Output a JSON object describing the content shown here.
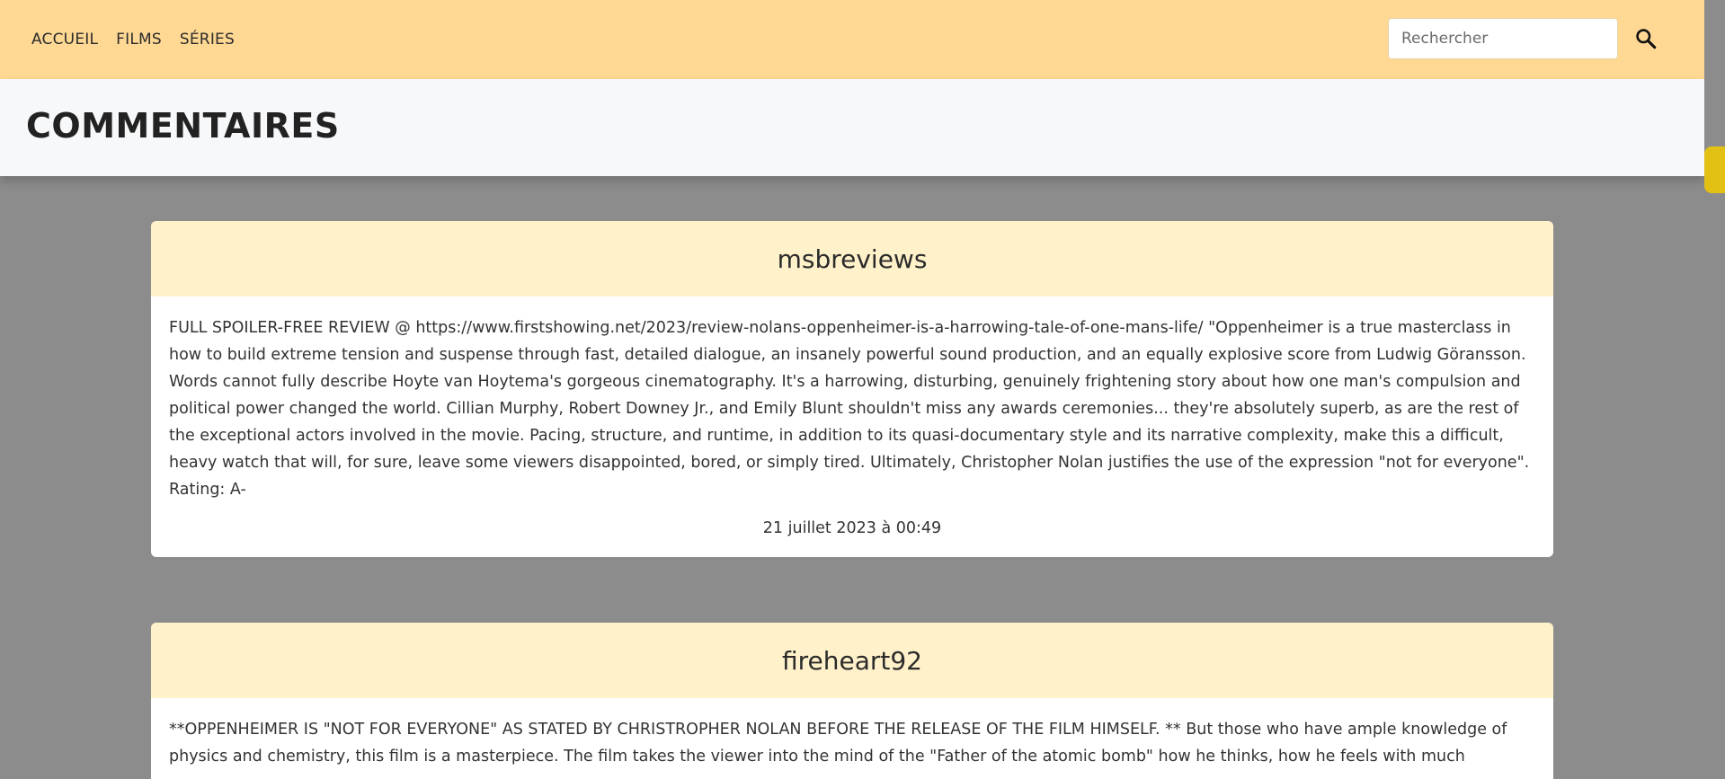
{
  "nav": {
    "links": [
      "ACCUEIL",
      "FILMS",
      "SÉRIES"
    ],
    "search_placeholder": "Rechercher",
    "search_icon": "search-icon"
  },
  "header": {
    "title": "COMMENTAIRES"
  },
  "comments": [
    {
      "author": "msbreviews",
      "text": "FULL SPOILER-FREE REVIEW @ https://www.firstshowing.net/2023/review-nolans-oppenheimer-is-a-harrowing-tale-of-one-mans-life/ \"Oppenheimer is a true masterclass in how to build extreme tension and suspense through fast, detailed dialogue, an insanely powerful sound production, and an equally explosive score from Ludwig Göransson. Words cannot fully describe Hoyte van Hoytema's gorgeous cinematography. It's a harrowing, disturbing, genuinely frightening story about how one man's compulsion and political power changed the world. Cillian Murphy, Robert Downey Jr., and Emily Blunt shouldn't miss any awards ceremonies... they're absolutely superb, as are the rest of the exceptional actors involved in the movie. Pacing, structure, and runtime, in addition to its quasi-documentary style and its narrative complexity, make this a difficult, heavy watch that will, for sure, leave some viewers disappointed, bored, or simply tired. Ultimately, Christopher Nolan justifies the use of the expression \"not for everyone\". Rating: A-",
      "date": "21 juillet 2023 à 00:49"
    },
    {
      "author": "fireheart92",
      "text": "**OPPENHEIMER IS \"NOT FOR EVERYONE\" AS STATED BY CHRISTROPHER NOLAN BEFORE THE RELEASE OF THE FILM HIMSELF. ** But those who have ample knowledge of physics and chemistry, this film is a masterpiece. The film takes the viewer into the mind of the \"Father of the atomic bomb\" how he thinks, how he feels with much",
      "date": ""
    }
  ],
  "colors": {
    "navbar": "#ffd894",
    "header_band": "#f7f8fa",
    "backdrop": "#8c8c8c",
    "card_header": "#fff1c9",
    "scroll_thumb": "#e3c014"
  }
}
